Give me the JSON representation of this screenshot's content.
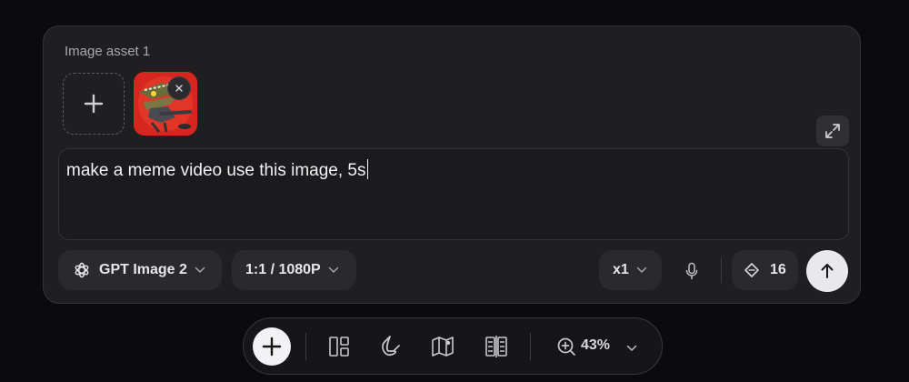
{
  "asset_section": {
    "label": "Image asset 1",
    "thumbnail_name": "alligator-game-icon"
  },
  "prompt": {
    "text": "make a meme video use this image, 5s"
  },
  "controls": {
    "model_label": "GPT Image 2",
    "ratio_label": "1:1 / 1080P",
    "count_label": "x1",
    "credits_label": "16"
  },
  "toolbar": {
    "zoom_label": "43%"
  },
  "icons": {
    "add": "plus-icon",
    "remove": "close-icon",
    "expand": "expand-icon",
    "model": "openai-icon",
    "chevron": "chevron-down-icon",
    "mic": "microphone-icon",
    "credits": "diamond-icon",
    "send": "arrow-up-icon",
    "layout": "layout-grid-icon",
    "magnet": "magnet-icon",
    "map": "map-icon",
    "split": "split-view-icon",
    "zoom": "zoom-in-icon"
  },
  "colors": {
    "background": "#0b0b0d",
    "panel": "#1f1f21",
    "send_button": "#e9e9eb",
    "thumbnail_bg": "#d2231f"
  }
}
